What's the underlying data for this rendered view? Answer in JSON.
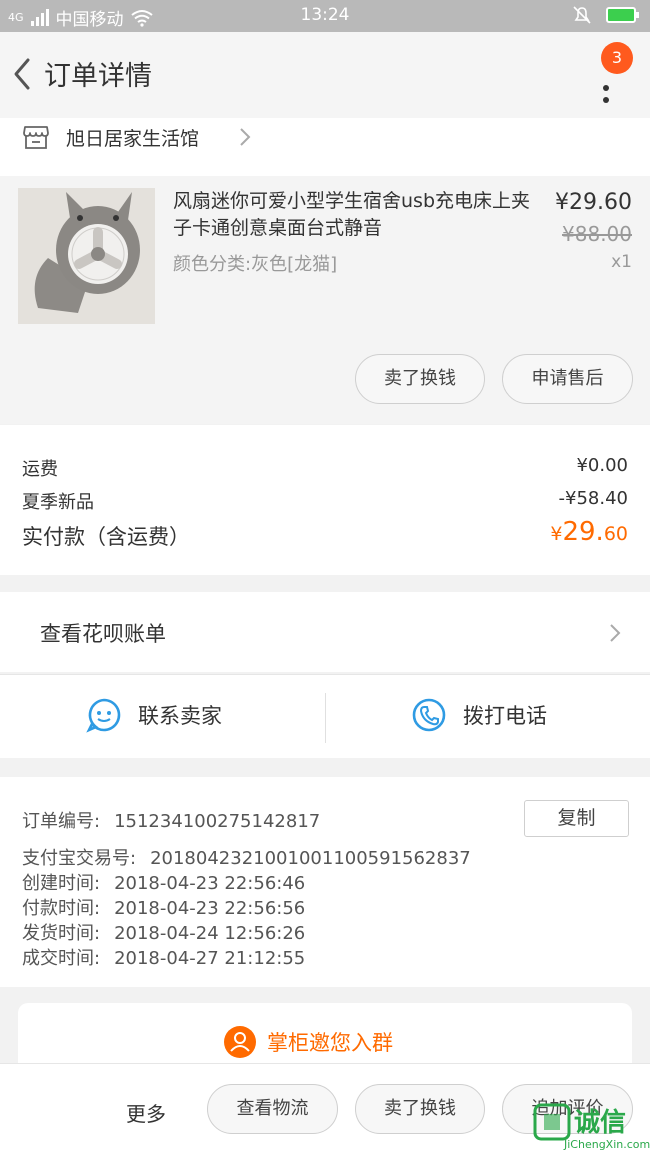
{
  "status_bar": {
    "network": "4G",
    "carrier": "中国移动",
    "time": "13:24"
  },
  "header": {
    "title": "订单详情",
    "badge_count": "3"
  },
  "shop": {
    "name": "旭日居家生活馆"
  },
  "product": {
    "title": "风扇迷你可爱小型学生宿舍usb充电床上夹子卡通创意桌面台式静音",
    "sku": "颜色分类:灰色[龙猫]",
    "price": "¥29.60",
    "original_price": "¥88.00",
    "quantity": "x1",
    "actions": {
      "sell": "卖了换钱",
      "aftersale": "申请售后"
    }
  },
  "costs": {
    "shipping_label": "运费",
    "shipping_value": "¥0.00",
    "discount_label": "夏季新品",
    "discount_value": "-¥58.40",
    "paid_label": "实付款（含运费）",
    "paid_currency": "¥",
    "paid_int": "29.",
    "paid_dec": "60"
  },
  "bill": {
    "label": "查看花呗账单"
  },
  "contact": {
    "seller": "联系卖家",
    "phone": "拨打电话"
  },
  "order_info": {
    "copy_label": "复制",
    "rows": [
      {
        "label": "订单编号:",
        "value": "151234100275142817"
      },
      {
        "label": "支付宝交易号:",
        "value": "2018042321001001100591562837"
      },
      {
        "label": "创建时间:",
        "value": "2018-04-23 22:56:46"
      },
      {
        "label": "付款时间:",
        "value": "2018-04-23 22:56:56"
      },
      {
        "label": "发货时间:",
        "value": "2018-04-24 12:56:26"
      },
      {
        "label": "成交时间:",
        "value": "2018-04-27 21:12:55"
      }
    ]
  },
  "group": {
    "label": "掌柜邀您入群"
  },
  "bottom_bar": {
    "more": "更多",
    "logistics": "查看物流",
    "sell": "卖了换钱",
    "review": "追加评价"
  },
  "watermark": {
    "cn": "诚信",
    "en": "JiChengXin.com"
  },
  "colors": {
    "accent": "#ff6a00",
    "badge": "#ff5a1e",
    "icon_blue": "#2f9be3"
  }
}
